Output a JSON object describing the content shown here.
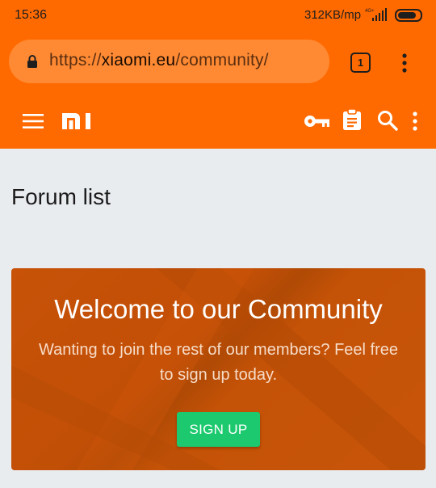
{
  "status_bar": {
    "time": "15:36",
    "network_speed": "312KB/mp",
    "network_type": "4G+"
  },
  "browser": {
    "url_scheme": "https://",
    "url_host": "xiaomi.eu",
    "url_path": "/community/",
    "tab_count": "1"
  },
  "site_header": {
    "logo": "MI",
    "icons": [
      "menu-icon",
      "key-icon",
      "clipboard-icon",
      "search-icon",
      "more-vert-icon"
    ]
  },
  "page": {
    "title": "Forum list"
  },
  "welcome": {
    "title": "Welcome to our Community",
    "text": "Wanting to join the rest of our members? Feel free to sign up today.",
    "button_label": "SIGN UP"
  },
  "colors": {
    "brand": "#ff6a00",
    "card": "#c55308",
    "button": "#1dc96e",
    "background": "#e9ecef"
  }
}
